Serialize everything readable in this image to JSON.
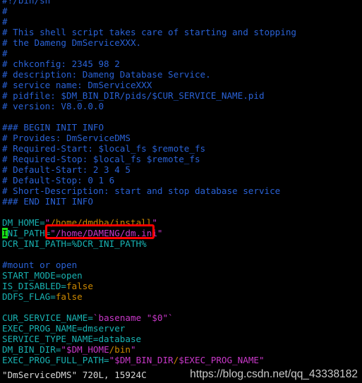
{
  "terminal": {
    "title": "DmServiceDMS",
    "background": "#000000",
    "colors": {
      "comment": "#2a62d6",
      "variable": "#18b2b2",
      "string": "#c838c8",
      "path": "#cc8800",
      "cursor_bg": "#18e018",
      "annotation": "#ff0000",
      "status_text": "#d8d8d8",
      "watermark": "#c9c9c9"
    }
  },
  "cursor": {
    "char": "I",
    "line_index": 22,
    "column": 0
  },
  "annotation": {
    "shape": "rectangle",
    "color": "#ff0000",
    "targets_line_index": 22,
    "targets_text": "/home/DAMENG/dm.ini\""
  },
  "status": {
    "text": "\"DmServiceDMS\" 720L, 15924C"
  },
  "watermark": {
    "text": "https://blog.csdn.net/qq_43338182"
  },
  "lines": [
    {
      "id": "l0",
      "segments": [
        {
          "t": "#!/bin/sh",
          "c": "comment"
        }
      ]
    },
    {
      "id": "l1",
      "segments": [
        {
          "t": "#",
          "c": "comment"
        }
      ]
    },
    {
      "id": "l2",
      "segments": [
        {
          "t": "#",
          "c": "comment"
        }
      ]
    },
    {
      "id": "l3",
      "segments": [
        {
          "t": "# This shell script takes care of starting and stopping",
          "c": "comment"
        }
      ]
    },
    {
      "id": "l4",
      "segments": [
        {
          "t": "# the Dameng DmServiceXXX.",
          "c": "comment"
        }
      ]
    },
    {
      "id": "l5",
      "segments": [
        {
          "t": "#",
          "c": "comment"
        }
      ]
    },
    {
      "id": "l6",
      "segments": [
        {
          "t": "# chkconfig: 2345 98 2",
          "c": "comment"
        }
      ]
    },
    {
      "id": "l7",
      "segments": [
        {
          "t": "# description: Dameng Database Service.",
          "c": "comment"
        }
      ]
    },
    {
      "id": "l8",
      "segments": [
        {
          "t": "# service name: DmServiceXXX",
          "c": "comment"
        }
      ]
    },
    {
      "id": "l9",
      "segments": [
        {
          "t": "# pidfile: $DM_BIN_DIR/pids/$CUR_SERVICE_NAME.pid",
          "c": "comment"
        }
      ]
    },
    {
      "id": "l10",
      "segments": [
        {
          "t": "# version: V8.0.0.0",
          "c": "comment"
        }
      ]
    },
    {
      "id": "l11",
      "segments": [
        {
          "t": "",
          "c": "comment"
        }
      ]
    },
    {
      "id": "l12",
      "segments": [
        {
          "t": "### BEGIN INIT INFO",
          "c": "comment"
        }
      ]
    },
    {
      "id": "l13",
      "segments": [
        {
          "t": "# Provides: DmServiceDMS",
          "c": "comment"
        }
      ]
    },
    {
      "id": "l14",
      "segments": [
        {
          "t": "# Required-Start: $local_fs $remote_fs",
          "c": "comment"
        }
      ]
    },
    {
      "id": "l15",
      "segments": [
        {
          "t": "# Required-Stop: $local_fs $remote_fs",
          "c": "comment"
        }
      ]
    },
    {
      "id": "l16",
      "segments": [
        {
          "t": "# Default-Start: 2 3 4 5",
          "c": "comment"
        }
      ]
    },
    {
      "id": "l17",
      "segments": [
        {
          "t": "# Default-Stop: 0 1 6",
          "c": "comment"
        }
      ]
    },
    {
      "id": "l18",
      "segments": [
        {
          "t": "# Short-Description: start and stop database service",
          "c": "comment"
        }
      ]
    },
    {
      "id": "l19",
      "segments": [
        {
          "t": "### END INIT INFO",
          "c": "comment"
        }
      ]
    },
    {
      "id": "l20",
      "segments": [
        {
          "t": "",
          "c": "comment"
        }
      ]
    },
    {
      "id": "l21",
      "segments": [
        {
          "t": "DM_HOME=",
          "c": "variable"
        },
        {
          "t": "\"",
          "c": "string"
        },
        {
          "t": "/home/dmdba/install",
          "c": "path"
        },
        {
          "t": "\"",
          "c": "string"
        }
      ]
    },
    {
      "id": "l22",
      "segments": [
        {
          "t": "I",
          "c": "cursor"
        },
        {
          "t": "NI_PATH=",
          "c": "variable"
        },
        {
          "t": "\"",
          "c": "string"
        },
        {
          "t": "/home/DAMENG/dm.ini",
          "c": "string"
        },
        {
          "t": "\"",
          "c": "string"
        }
      ]
    },
    {
      "id": "l23",
      "segments": [
        {
          "t": "DCR_INI_PATH=%DCR_INI_PATH%",
          "c": "variable"
        }
      ]
    },
    {
      "id": "l24",
      "segments": [
        {
          "t": "",
          "c": "variable"
        }
      ]
    },
    {
      "id": "l25",
      "segments": [
        {
          "t": "#mount or open",
          "c": "comment"
        }
      ]
    },
    {
      "id": "l26",
      "segments": [
        {
          "t": "START_MODE=open",
          "c": "variable"
        }
      ]
    },
    {
      "id": "l27",
      "segments": [
        {
          "t": "IS_DISABLED=",
          "c": "variable"
        },
        {
          "t": "false",
          "c": "value"
        }
      ]
    },
    {
      "id": "l28",
      "segments": [
        {
          "t": "DDFS_FLAG=",
          "c": "variable"
        },
        {
          "t": "false",
          "c": "value"
        }
      ]
    },
    {
      "id": "l29",
      "segments": [
        {
          "t": "",
          "c": "variable"
        }
      ]
    },
    {
      "id": "l30",
      "segments": [
        {
          "t": "CUR_SERVICE_NAME=",
          "c": "variable"
        },
        {
          "t": "`basename \"$0\"`",
          "c": "string"
        }
      ]
    },
    {
      "id": "l31",
      "segments": [
        {
          "t": "EXEC_PROG_NAME=dmserver",
          "c": "variable"
        }
      ]
    },
    {
      "id": "l32",
      "segments": [
        {
          "t": "SERVICE_TYPE_NAME=database",
          "c": "variable"
        }
      ]
    },
    {
      "id": "l33",
      "segments": [
        {
          "t": "DM_BIN_DIR=",
          "c": "variable"
        },
        {
          "t": "\"$DM_HOME",
          "c": "string"
        },
        {
          "t": "/bin",
          "c": "path"
        },
        {
          "t": "\"",
          "c": "string"
        }
      ]
    },
    {
      "id": "l34",
      "segments": [
        {
          "t": "EXEC_PROG_FULL_PATH=",
          "c": "variable"
        },
        {
          "t": "\"$DM_BIN_DIR",
          "c": "string"
        },
        {
          "t": "/",
          "c": "path"
        },
        {
          "t": "$EXEC_PROG_NAME\"",
          "c": "string"
        }
      ]
    }
  ]
}
